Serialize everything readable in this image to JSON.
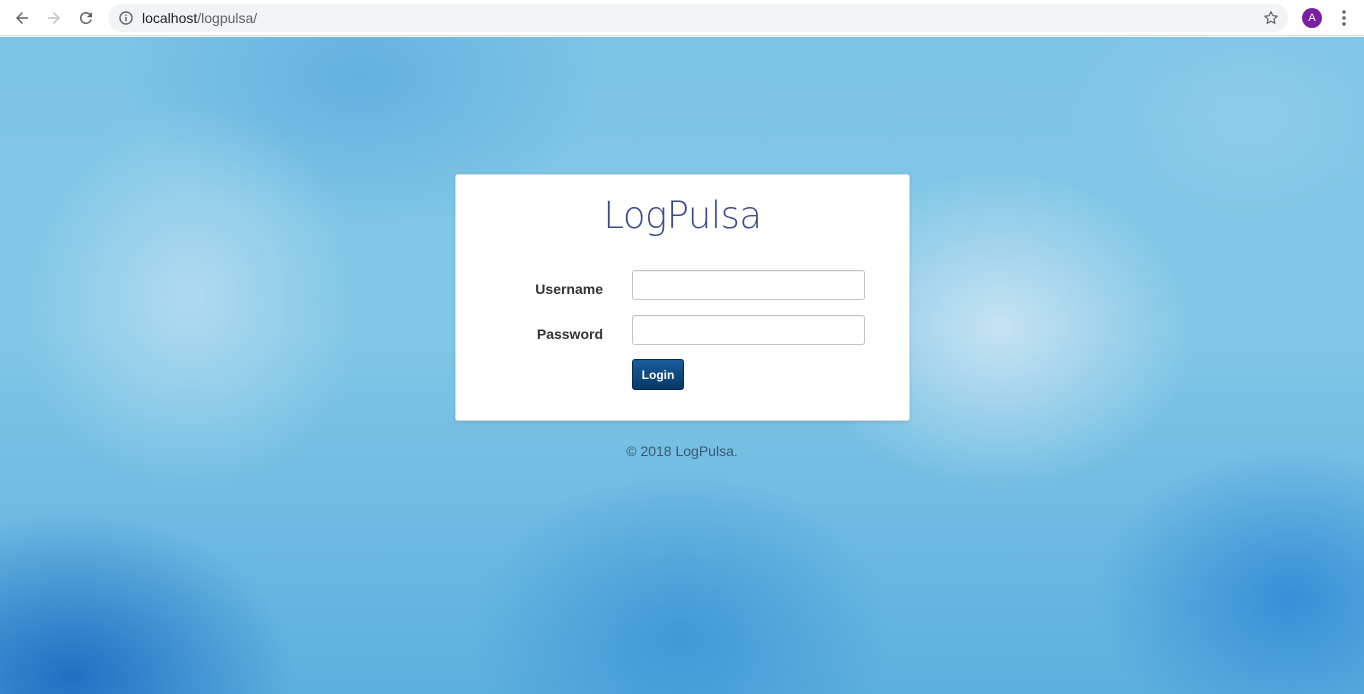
{
  "browser": {
    "url_host": "localhost",
    "url_path": "/logpulsa/",
    "profile_initial": "A",
    "profile_color": "#7b1fa2",
    "icons": {
      "back": "arrow-left-icon",
      "forward": "arrow-right-icon",
      "reload": "reload-icon",
      "site_info": "info-icon",
      "bookmark": "star-icon",
      "menu": "kebab-menu-icon"
    }
  },
  "login": {
    "logo": "LogPulsa",
    "username_label": "Username",
    "username_value": "",
    "password_label": "Password",
    "password_value": "",
    "submit_label": "Login"
  },
  "footer": {
    "copyright": "© 2018 LogPulsa."
  },
  "colors": {
    "logo": "#3b4a8a",
    "button": "#0a4275",
    "background": "#7cc4e6"
  }
}
